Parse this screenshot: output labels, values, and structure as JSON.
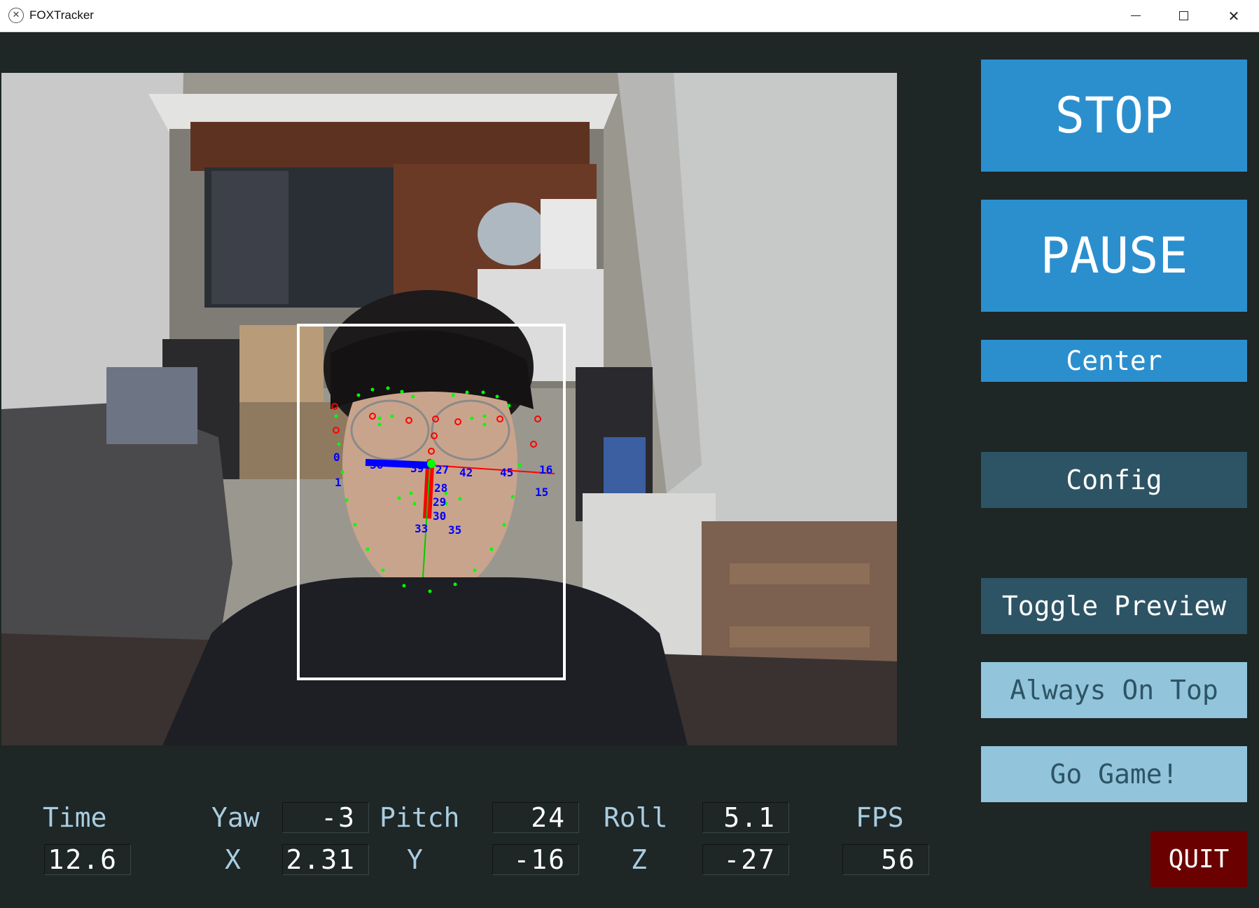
{
  "window": {
    "title": "FOXTracker",
    "icon": "fox-app-icon",
    "controls": {
      "minimize": "minimize-icon",
      "maximize": "maximize-icon",
      "close": "close-icon"
    }
  },
  "buttons": {
    "stop": "STOP",
    "pause": "PAUSE",
    "center": "Center",
    "config": "Config",
    "toggle_preview": "Toggle Preview",
    "always_on_top": "Always On Top",
    "go_game": "Go Game!",
    "quit": "QUIT"
  },
  "readouts": {
    "time": {
      "label": "Time",
      "value": "12.6"
    },
    "yaw": {
      "label": "Yaw",
      "value": "-3"
    },
    "pitch": {
      "label": "Pitch",
      "value": "24"
    },
    "roll": {
      "label": "Roll",
      "value": "5.1"
    },
    "fps": {
      "label": "FPS",
      "value": "56"
    },
    "x": {
      "label": "X",
      "value": "2.31"
    },
    "y": {
      "label": "Y",
      "value": "-16"
    },
    "z": {
      "label": "Z",
      "value": "-27"
    }
  },
  "preview": {
    "landmark_labels": [
      "0",
      "1",
      "36",
      "39",
      "27",
      "42",
      "45",
      "16",
      "15",
      "28",
      "29",
      "30",
      "33",
      "35"
    ],
    "colors": {
      "box": "#ffffff",
      "landmark_dot": "#00ff00",
      "landmark_ring": "#ff0000",
      "label": "#0000ff",
      "axis_x": "#ff0000",
      "axis_y": "#00cc00",
      "axis_z": "#0000ff"
    }
  },
  "theme": {
    "background": "#1e2626",
    "primary": "#2b8fce",
    "secondary": "#2d5465",
    "light": "#92c5dc",
    "danger": "#6b0000",
    "label_text": "#a9cde0"
  }
}
